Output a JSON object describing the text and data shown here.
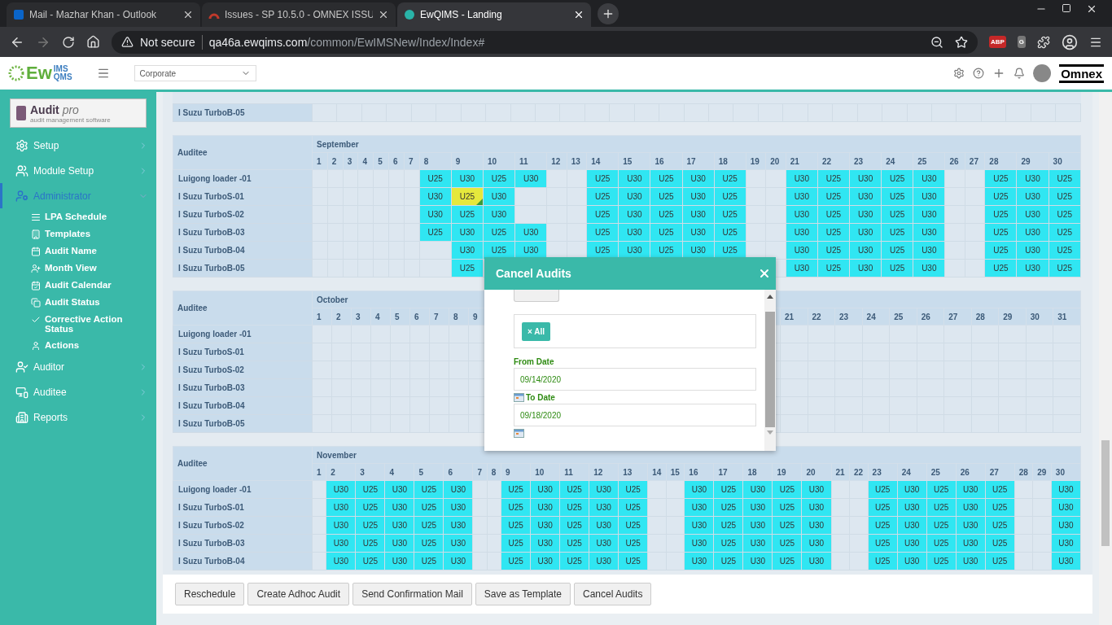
{
  "browser": {
    "tabs": [
      {
        "title": "Mail - Mazhar Khan - Outlook",
        "selected": false
      },
      {
        "title": "Issues - SP 10.5.0 - OMNEX ISSU",
        "selected": false
      },
      {
        "title": "EwQIMS - Landing",
        "selected": true
      }
    ],
    "security": "Not secure",
    "url_host": "qa46a.ewqims.com",
    "url_path": "/common/EwIMSNew/Index/Index#",
    "extensions": [
      "ABP",
      "G"
    ]
  },
  "header": {
    "logo": {
      "main": "Ew",
      "top": "IMS",
      "bottom": "QMS"
    },
    "site_select": "Corporate",
    "brand": "Omnex"
  },
  "sidebar": {
    "logo": {
      "title": "Audit",
      "accent": "pro",
      "tagline": "audit management software"
    },
    "items": [
      {
        "label": "Setup",
        "expanded": false,
        "selected": false
      },
      {
        "label": "Module Setup",
        "expanded": false,
        "selected": false
      },
      {
        "label": "Administrator",
        "expanded": true,
        "selected": true,
        "children": [
          {
            "label": "LPA Schedule"
          },
          {
            "label": "Templates"
          },
          {
            "label": "Audit Name"
          },
          {
            "label": "Month View"
          },
          {
            "label": "Audit Calendar"
          },
          {
            "label": "Audit Status"
          },
          {
            "label": "Corrective Action Status"
          },
          {
            "label": "Actions"
          }
        ]
      },
      {
        "label": "Auditor",
        "expanded": false,
        "selected": false
      },
      {
        "label": "Auditee",
        "expanded": false,
        "selected": false
      },
      {
        "label": "Reports",
        "expanded": false,
        "selected": false
      }
    ]
  },
  "partial_block": {
    "rows": [
      {
        "name": "I Suzu TurboB-05"
      }
    ]
  },
  "months": [
    {
      "name": "September",
      "column_header": "Auditee",
      "days": [
        "1",
        "2",
        "3",
        "4",
        "5",
        "6",
        "7",
        "8",
        "9",
        "10",
        "11",
        "12",
        "13",
        "14",
        "15",
        "16",
        "17",
        "18",
        "19",
        "20",
        "21",
        "22",
        "23",
        "24",
        "25",
        "26",
        "27",
        "28",
        "29",
        "30"
      ],
      "rows": [
        {
          "name": "Luigong loader -01",
          "cells": [
            null,
            null,
            null,
            null,
            null,
            null,
            null,
            "U25",
            "U30",
            "U25",
            "U30",
            null,
            null,
            "U25",
            "U30",
            "U25",
            "U30",
            "U25",
            null,
            null,
            "U30",
            "U25",
            "U30",
            "U25",
            "U30",
            null,
            null,
            "U25",
            "U30",
            "U25"
          ]
        },
        {
          "name": "I Suzu TurboS-01",
          "cells": [
            null,
            null,
            null,
            null,
            null,
            null,
            null,
            "U30",
            {
              "text": "U25",
              "flagged": true
            },
            "U30",
            null,
            null,
            null,
            "U25",
            "U30",
            "U25",
            "U30",
            "U25",
            null,
            null,
            "U30",
            "U25",
            "U30",
            "U25",
            "U30",
            null,
            null,
            "U25",
            "U30",
            "U25"
          ]
        },
        {
          "name": "I Suzu TurboS-02",
          "cells": [
            null,
            null,
            null,
            null,
            null,
            null,
            null,
            "U30",
            "U25",
            "U30",
            null,
            null,
            null,
            "U25",
            "U30",
            "U25",
            "U30",
            "U25",
            null,
            null,
            "U30",
            "U25",
            "U30",
            "U25",
            "U30",
            null,
            null,
            "U25",
            "U30",
            "U25"
          ]
        },
        {
          "name": "I Suzu TurboB-03",
          "cells": [
            null,
            null,
            null,
            null,
            null,
            null,
            null,
            "U25",
            "U30",
            "U25",
            "U30",
            null,
            null,
            "U25",
            "U30",
            "U25",
            "U30",
            "U25",
            null,
            null,
            "U30",
            "U25",
            "U30",
            "U25",
            "U30",
            null,
            null,
            "U25",
            "U30",
            "U25"
          ]
        },
        {
          "name": "I Suzu TurboB-04",
          "cells": [
            null,
            null,
            null,
            null,
            null,
            null,
            null,
            null,
            "U30",
            "U25",
            "U30",
            null,
            null,
            "U25",
            "U30",
            "U25",
            "U30",
            "U25",
            null,
            null,
            "U30",
            "U25",
            "U30",
            "U25",
            "U30",
            null,
            null,
            "U25",
            "U30",
            "U25"
          ]
        },
        {
          "name": "I Suzu TurboB-05",
          "cells": [
            null,
            null,
            null,
            null,
            null,
            null,
            null,
            null,
            "U25",
            null,
            null,
            null,
            null,
            null,
            null,
            null,
            null,
            null,
            null,
            null,
            "U30",
            "U25",
            "U30",
            "U25",
            "U30",
            null,
            null,
            "U25",
            "U30",
            "U25"
          ]
        }
      ]
    },
    {
      "name": "October",
      "column_header": "Auditee",
      "days": [
        "1",
        "2",
        "3",
        "4",
        "5",
        "6",
        "7",
        "8",
        "9"
      ],
      "days_after_gap": [
        "21",
        "22",
        "23",
        "24",
        "25",
        "26",
        "27",
        "28",
        "29",
        "30",
        "31"
      ],
      "rows": [
        {
          "name": "Luigong loader -01"
        },
        {
          "name": "I Suzu TurboS-01"
        },
        {
          "name": "I Suzu TurboS-02"
        },
        {
          "name": "I Suzu TurboB-03"
        },
        {
          "name": "I Suzu TurboB-04"
        },
        {
          "name": "I Suzu TurboB-05"
        }
      ]
    },
    {
      "name": "November",
      "column_header": "Auditee",
      "days": [
        "1",
        "2",
        "3",
        "4",
        "5",
        "6",
        "7",
        "8",
        "9",
        "10",
        "11",
        "12",
        "13",
        "14",
        "15",
        "16",
        "17",
        "18",
        "19",
        "20",
        "21",
        "22",
        "23",
        "24",
        "25",
        "26",
        "27",
        "28",
        "29",
        "30"
      ],
      "rows": [
        {
          "name": "Luigong loader -01",
          "cells": [
            null,
            "U30",
            "U25",
            "U30",
            "U25",
            "U30",
            null,
            null,
            "U25",
            "U30",
            "U25",
            "U30",
            "U25",
            null,
            null,
            "U30",
            "U25",
            "U30",
            "U25",
            "U30",
            null,
            null,
            "U25",
            "U30",
            "U25",
            "U30",
            "U25",
            null,
            null,
            "U30"
          ]
        },
        {
          "name": "I Suzu TurboS-01",
          "cells": [
            null,
            "U30",
            "U25",
            "U30",
            "U25",
            "U30",
            null,
            null,
            "U25",
            "U30",
            "U25",
            "U30",
            "U25",
            null,
            null,
            "U30",
            "U25",
            "U30",
            "U25",
            "U30",
            null,
            null,
            "U25",
            "U30",
            "U25",
            "U30",
            "U25",
            null,
            null,
            "U30"
          ]
        },
        {
          "name": "I Suzu TurboS-02",
          "cells": [
            null,
            "U30",
            "U25",
            "U30",
            "U25",
            "U30",
            null,
            null,
            "U25",
            "U30",
            "U25",
            "U30",
            "U25",
            null,
            null,
            "U30",
            "U25",
            "U30",
            "U25",
            "U30",
            null,
            null,
            "U25",
            "U30",
            "U25",
            "U30",
            "U25",
            null,
            null,
            "U30"
          ]
        },
        {
          "name": "I Suzu TurboB-03",
          "cells": [
            null,
            "U30",
            "U25",
            "U30",
            "U25",
            "U30",
            null,
            null,
            "U25",
            "U30",
            "U25",
            "U30",
            "U25",
            null,
            null,
            "U30",
            "U25",
            "U30",
            "U25",
            "U30",
            null,
            null,
            "U25",
            "U30",
            "U25",
            "U30",
            "U25",
            null,
            null,
            "U30"
          ]
        },
        {
          "name": "I Suzu TurboB-04",
          "cells": [
            null,
            "U30",
            "U25",
            "U30",
            "U25",
            "U30",
            null,
            null,
            "U25",
            "U30",
            "U25",
            "U30",
            "U25",
            null,
            null,
            "U30",
            "U25",
            "U30",
            "U25",
            "U30",
            null,
            null,
            "U25",
            "U30",
            "U25",
            "U30",
            "U25",
            null,
            null,
            "U30"
          ]
        }
      ]
    }
  ],
  "actions": [
    "Reschedule",
    "Create Adhoc Audit",
    "Send Confirmation Mail",
    "Save as Template",
    "Cancel Audits"
  ],
  "modal": {
    "title": "Cancel Audits",
    "tags": [
      "All"
    ],
    "tag_remove": "×",
    "fields": [
      {
        "label": "From Date",
        "value": "09/14/2020"
      },
      {
        "label": "To Date",
        "value": "09/18/2020"
      }
    ]
  }
}
